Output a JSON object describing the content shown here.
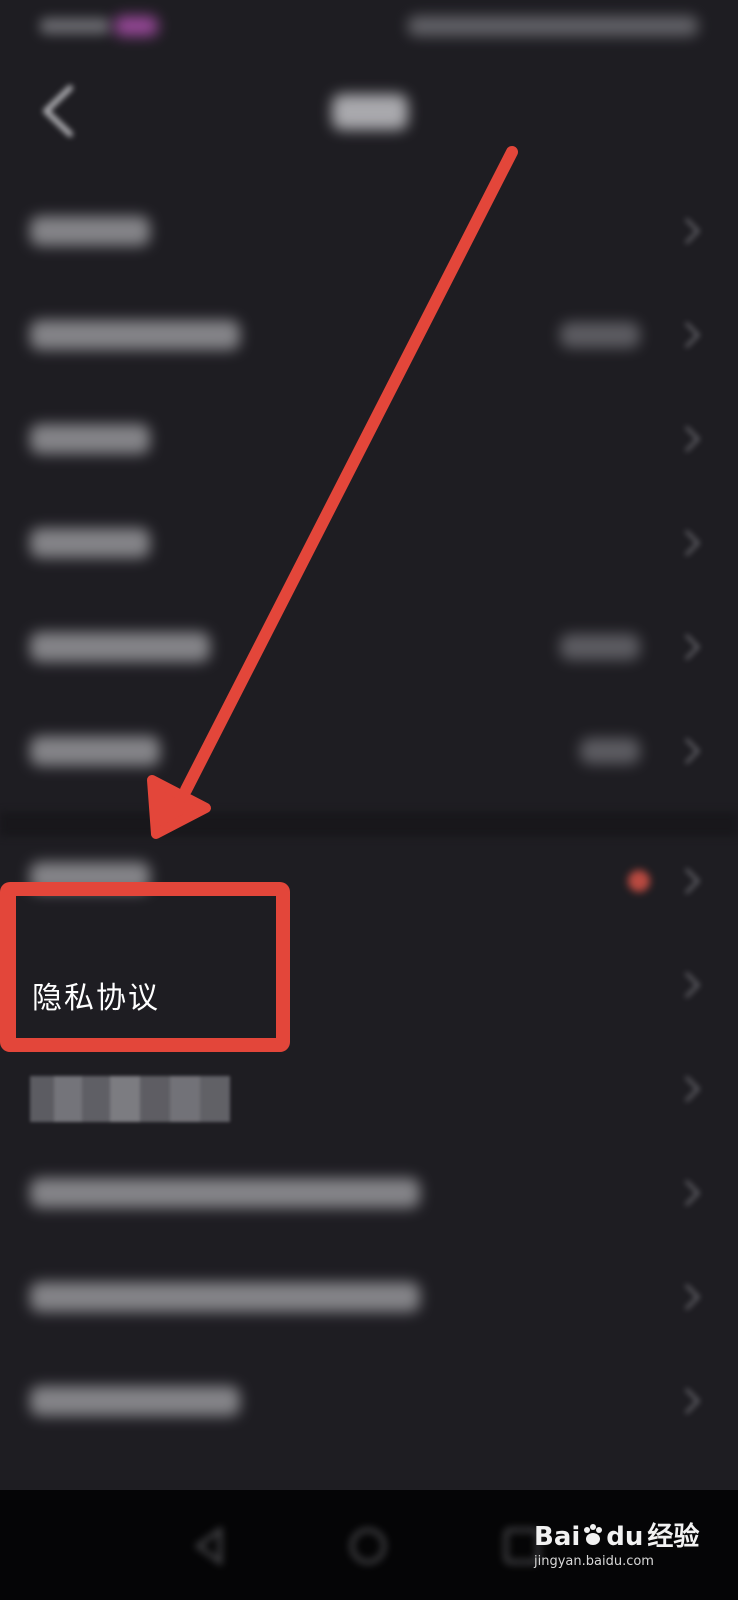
{
  "settings": {
    "highlighted_item_label": "隐私协议"
  },
  "annotation": {
    "color": "#e3463a"
  },
  "watermark": {
    "brand_latin": "Bai",
    "brand_du": "du",
    "brand_cn": "经验",
    "url": "jingyan.baidu.com"
  },
  "icons": [
    "back-icon",
    "chevron-right-icon",
    "red-dot-icon",
    "paw-icon",
    "nav-back-icon",
    "nav-home-icon",
    "nav-recents-icon"
  ]
}
